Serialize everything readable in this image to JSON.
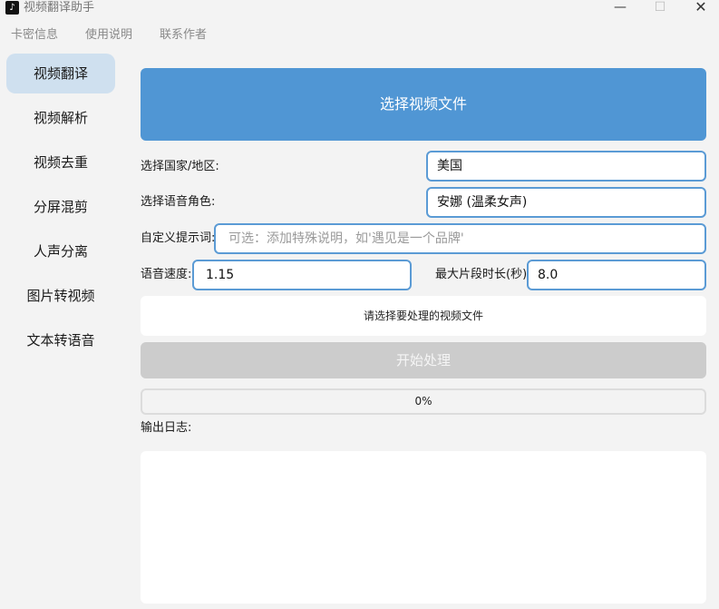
{
  "window": {
    "title": "视频翻译助手",
    "app_icon": "tiktok-icon",
    "controls": {
      "minimize": "—",
      "maximize": "☐",
      "close": "✕"
    }
  },
  "menu": [
    "卡密信息",
    "使用说明",
    "联系作者"
  ],
  "sidebar": {
    "items": [
      {
        "label": "视频翻译",
        "active": true
      },
      {
        "label": "视频解析",
        "active": false
      },
      {
        "label": "视频去重",
        "active": false
      },
      {
        "label": "分屏混剪",
        "active": false
      },
      {
        "label": "人声分离",
        "active": false
      },
      {
        "label": "图片转视频",
        "active": false
      },
      {
        "label": "文本转语音",
        "active": false
      }
    ]
  },
  "main": {
    "select_file_button": "选择视频文件",
    "country": {
      "label": "选择国家/地区:",
      "value": "美国"
    },
    "voice": {
      "label": "选择语音角色:",
      "value": "安娜 (温柔女声)"
    },
    "prompt": {
      "label": "自定义提示词:",
      "value": "",
      "placeholder": "可选：添加特殊说明，如'遇见是一个品牌'"
    },
    "speed": {
      "label": "语音速度:",
      "value": "1.15"
    },
    "max_segment": {
      "label": "最大片段时长(秒):",
      "value": "8.0"
    },
    "file_status": "请选择要处理的视频文件",
    "start_button": "开始处理",
    "progress": {
      "value": 0,
      "text": "0%"
    },
    "log_label": "输出日志:",
    "log_text": ""
  },
  "colors": {
    "accent": "#5096d4",
    "sidebar_active": "#cfe0ef",
    "disabled": "#cccccc",
    "background": "#f3f3f3"
  }
}
